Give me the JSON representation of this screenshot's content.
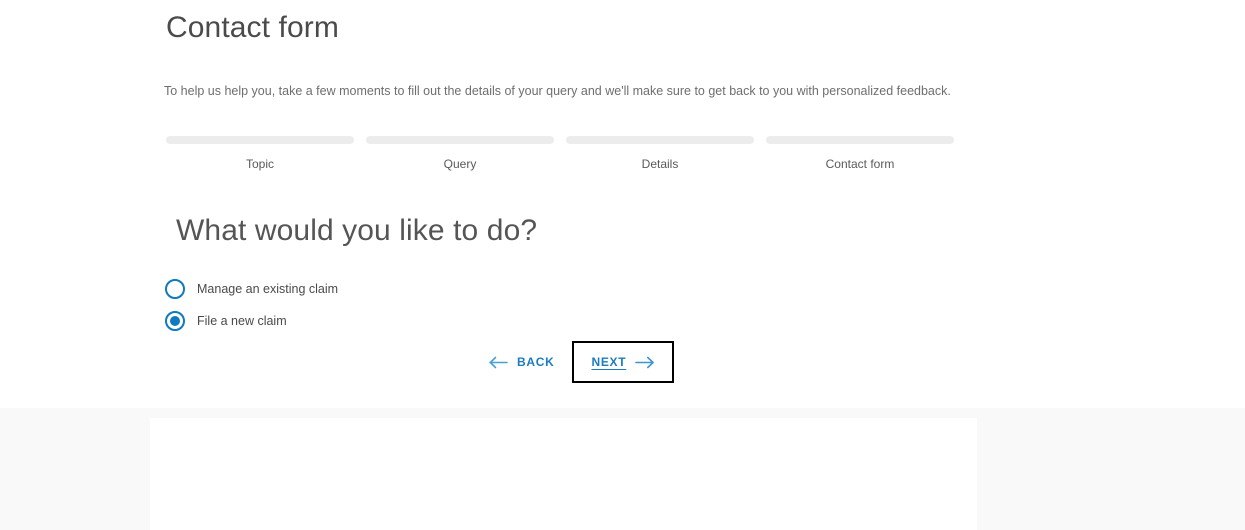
{
  "page": {
    "title": "Contact form",
    "intro": "To help us help you, take a few moments to fill out the details of your query and we'll make sure to get back to you with personalized feedback."
  },
  "stepper": {
    "steps": [
      {
        "label": "Topic"
      },
      {
        "label": "Query"
      },
      {
        "label": "Details"
      },
      {
        "label": "Contact form"
      }
    ]
  },
  "form": {
    "question": "What would you like to do?",
    "options": [
      {
        "label": "Manage an existing claim",
        "selected": false
      },
      {
        "label": "File a new claim",
        "selected": true
      }
    ]
  },
  "navigation": {
    "back_label": "BACK",
    "next_label": "NEXT",
    "back_icon": "arrow-left-icon",
    "next_icon": "arrow-right-icon"
  },
  "colors": {
    "accent_blue": "#1079bf",
    "link_blue": "#1b7cbf",
    "step_bar": "#ececec",
    "band_gray": "#f9f9f9",
    "focus_outline": "#000000"
  }
}
